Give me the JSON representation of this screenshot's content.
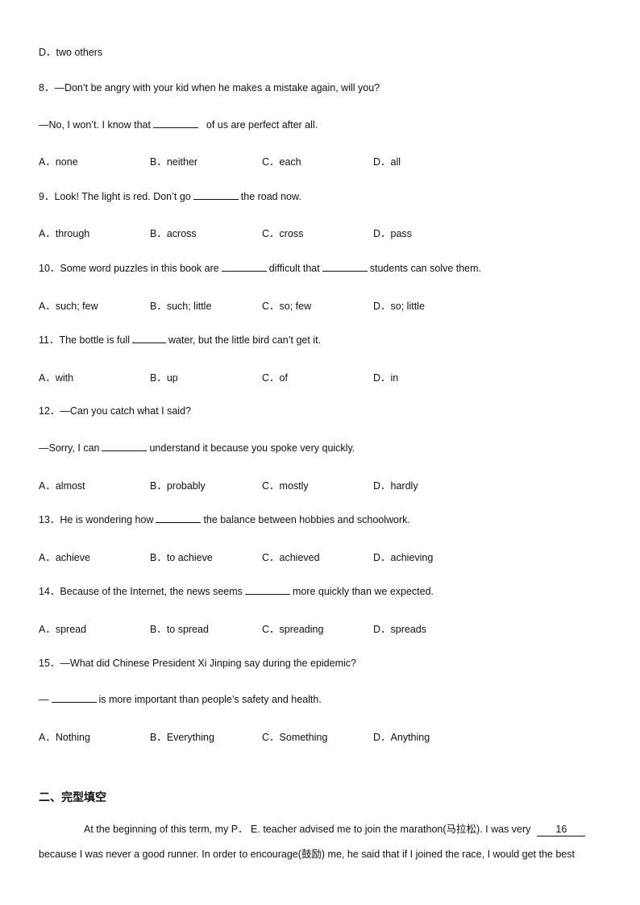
{
  "prev_option": "D．two others",
  "questions": [
    {
      "lines": [
        [
          {
            "t": "8．—Don’t be angry with your kid when he makes a mistake again, will you?"
          }
        ],
        [
          {
            "t": "—No, I won’t. I know that"
          },
          {
            "blank": 56
          },
          {
            "t": "  of us are perfect after all."
          }
        ]
      ],
      "options": [
        "A．none",
        "B．neither",
        "C．each",
        "D．all"
      ]
    },
    {
      "lines": [
        [
          {
            "t": "9．Look! The light is red. Don’t go"
          },
          {
            "blank": 56
          },
          {
            "t": "the road now."
          }
        ]
      ],
      "options": [
        "A．through",
        "B．across",
        "C．cross",
        "D．pass"
      ]
    },
    {
      "lines": [
        [
          {
            "t": "10．Some word puzzles in this book are"
          },
          {
            "blank": 56
          },
          {
            "t": "difficult that"
          },
          {
            "blank": 56
          },
          {
            "t": "students can solve them."
          }
        ]
      ],
      "options": [
        "A．such; few",
        "B．such; little",
        "C．so; few",
        "D．so; little"
      ]
    },
    {
      "lines": [
        [
          {
            "t": "11．The bottle is full"
          },
          {
            "blank": 42
          },
          {
            "t": "water, but the little bird can’t get it."
          }
        ]
      ],
      "options": [
        "A．with",
        "B．up",
        "C．of",
        "D．in"
      ]
    },
    {
      "lines": [
        [
          {
            "t": "12．—Can you catch what I said?"
          }
        ],
        [
          {
            "t": "—Sorry, I can"
          },
          {
            "blank": 56
          },
          {
            "t": "understand it because you spoke very quickly."
          }
        ]
      ],
      "options": [
        "A．almost",
        "B．probably",
        "C．mostly",
        "D．hardly"
      ]
    },
    {
      "lines": [
        [
          {
            "t": "13．He is wondering how"
          },
          {
            "blank": 56
          },
          {
            "t": "the balance between hobbies and schoolwork."
          }
        ]
      ],
      "options": [
        "A．achieve",
        "B．to achieve",
        "C．achieved",
        "D．achieving"
      ]
    },
    {
      "lines": [
        [
          {
            "t": "14．Because of the Internet, the news seems"
          },
          {
            "blank": 56
          },
          {
            "t": "more quickly than we expected."
          }
        ]
      ],
      "options": [
        "A．spread",
        "B．to spread",
        "C．spreading",
        "D．spreads"
      ]
    },
    {
      "lines": [
        [
          {
            "t": "15．—What did Chinese President Xi Jinping say during the epidemic?"
          }
        ],
        [
          {
            "t": "—"
          },
          {
            "blank": 56
          },
          {
            "t": "is more important than people’s safety and health."
          }
        ]
      ],
      "options": [
        "A．Nothing",
        "B．Everything",
        "C．Something",
        "D．Anything"
      ]
    }
  ],
  "section2": {
    "heading": "二、完型填空",
    "line1": "At the beginning of this term, my P． E. teacher advised me to join the marathon(马拉松). I was very",
    "blank_number": "16",
    "line2": "because I was never a good runner. In order to encourage(鼓励) me, he said that if I joined     the race, I would get the best"
  }
}
